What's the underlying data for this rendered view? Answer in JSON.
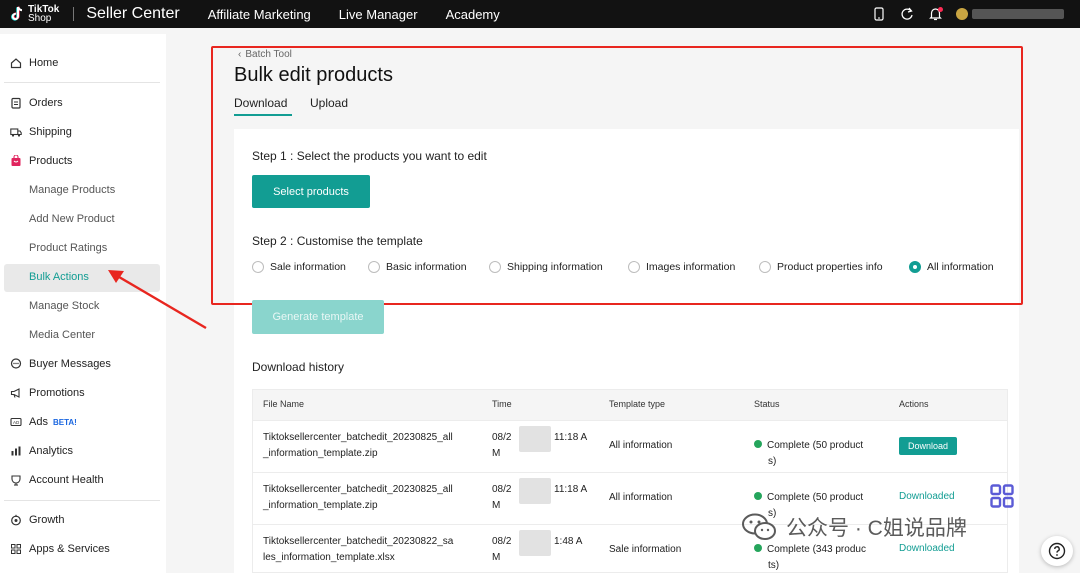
{
  "topbar": {
    "logo_text_line1": "TikTok",
    "logo_text_line2": "Shop",
    "title": "Seller Center",
    "nav": [
      "Affiliate Marketing",
      "Live Manager",
      "Academy"
    ],
    "icons": [
      "phone-icon",
      "refresh-icon",
      "bell-icon",
      "avatar"
    ]
  },
  "sidebar": {
    "items": [
      {
        "label": "Home",
        "icon": "home-icon"
      },
      {
        "label": "Orders",
        "icon": "clipboard-icon"
      },
      {
        "label": "Shipping",
        "icon": "truck-icon"
      },
      {
        "label": "Products",
        "icon": "bag-icon"
      },
      {
        "label": "Buyer Messages",
        "icon": "chat-icon"
      },
      {
        "label": "Promotions",
        "icon": "megaphone-icon"
      },
      {
        "label": "Ads",
        "icon": "ads-icon",
        "badge": "BETA!"
      },
      {
        "label": "Analytics",
        "icon": "chart-icon"
      },
      {
        "label": "Account Health",
        "icon": "health-icon"
      },
      {
        "label": "Growth",
        "icon": "growth-icon"
      },
      {
        "label": "Apps & Services",
        "icon": "apps-icon"
      }
    ],
    "product_sub": [
      "Manage Products",
      "Add New Product",
      "Product Ratings",
      "Bulk Actions",
      "Manage Stock",
      "Media Center"
    ]
  },
  "main": {
    "breadcrumb": "Batch Tool",
    "title": "Bulk edit products",
    "tabs": [
      "Download",
      "Upload"
    ],
    "step1_label": "Step 1 :  Select the products you want to edit",
    "select_button": "Select products",
    "step2_label": "Step 2 :  Customise the template",
    "options": [
      "Sale information",
      "Basic information",
      "Shipping information",
      "Images information",
      "Product properties info",
      "All information"
    ],
    "selected_option": "All information",
    "generate_button": "Generate template",
    "history_title": "Download history"
  },
  "table": {
    "headers": [
      "File Name",
      "Time",
      "Template type",
      "Status",
      "Actions"
    ],
    "rows": [
      {
        "file_line1": "Tiktoksellercenter_batchedit_20230825_all",
        "file_line2": "_information_template.zip",
        "time_a": "08/2",
        "time_b": "11:18 A",
        "time_c": "M",
        "type": "All information",
        "status_line1": "Complete (50 product",
        "status_line2": "s)",
        "action": "Download"
      },
      {
        "file_line1": "Tiktoksellercenter_batchedit_20230825_all",
        "file_line2": "_information_template.zip",
        "time_a": "08/2",
        "time_b": "11:18 A",
        "time_c": "M",
        "type": "All information",
        "status_line1": "Complete (50 product",
        "status_line2": "s)",
        "action": "Downloaded"
      },
      {
        "file_line1": "Tiktoksellercenter_batchedit_20230822_sa",
        "file_line2": "les_information_template.xlsx",
        "time_a": "08/2",
        "time_b": "1:48 A",
        "time_c": "M",
        "type": "Sale information",
        "status_line1": "Complete (343 produc",
        "status_line2": "ts)",
        "action": "Downloaded"
      }
    ]
  },
  "watermark": "公众号 · C姐说品牌",
  "colors": {
    "accent": "#129d93",
    "annotation": "#e8261f",
    "status_ok": "#25a55c"
  }
}
